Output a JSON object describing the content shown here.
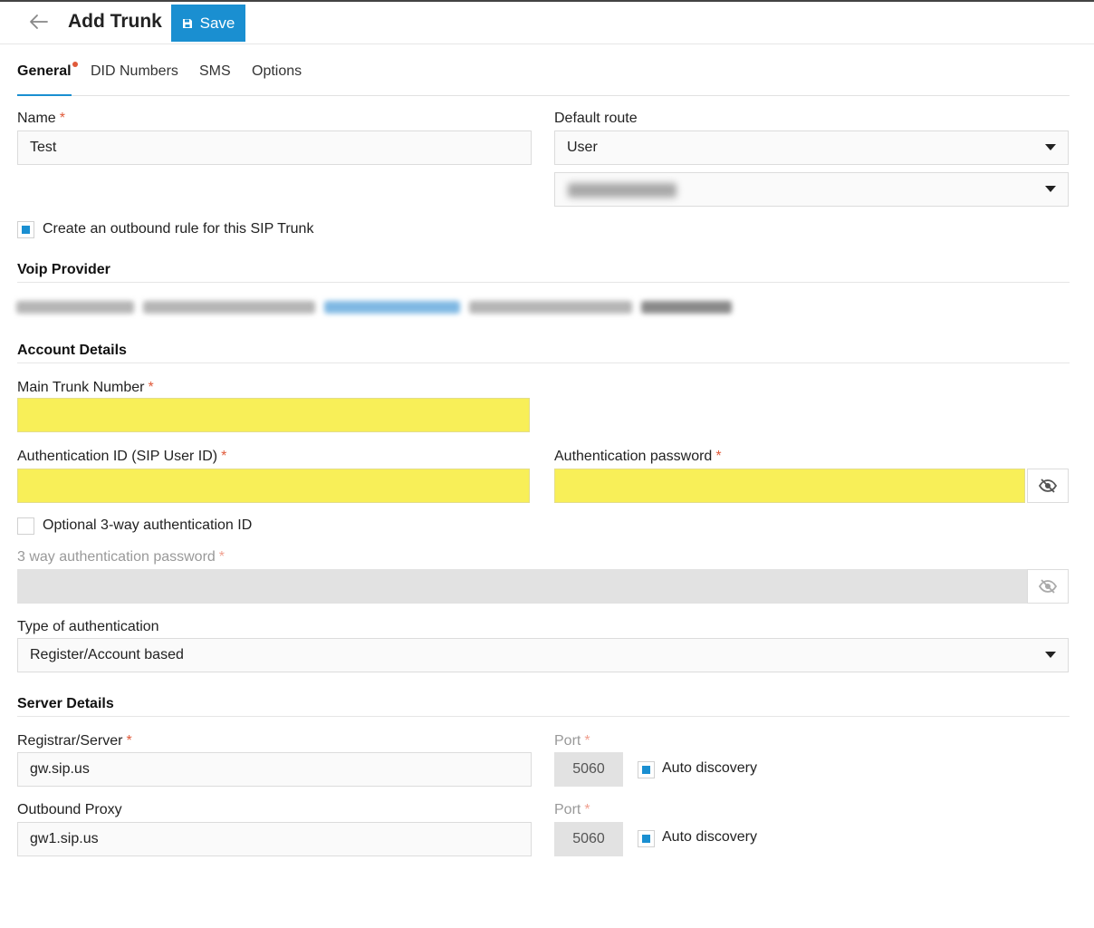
{
  "header": {
    "title": "Add Trunk",
    "save_label": "Save"
  },
  "tabs": [
    {
      "label": "General",
      "active": true,
      "has_error": true
    },
    {
      "label": "DID Numbers",
      "active": false
    },
    {
      "label": "SMS",
      "active": false
    },
    {
      "label": "Options",
      "active": false
    }
  ],
  "general": {
    "name": {
      "label": "Name",
      "value": "Test"
    },
    "default_route": {
      "label": "Default route",
      "value": "User"
    },
    "outbound_rule": {
      "label": "Create an outbound rule for this SIP Trunk",
      "checked": true
    }
  },
  "voip_provider": {
    "title": "Voip Provider"
  },
  "account": {
    "title": "Account Details",
    "main_trunk_number": {
      "label": "Main Trunk Number",
      "value": ""
    },
    "auth_id": {
      "label": "Authentication ID (SIP User ID)",
      "value": ""
    },
    "auth_password": {
      "label": "Authentication password",
      "value": ""
    },
    "three_way_id": {
      "label": "Optional 3-way authentication ID",
      "checked": false
    },
    "three_way_password": {
      "label": "3 way authentication password",
      "value": ""
    },
    "auth_type": {
      "label": "Type of authentication",
      "value": "Register/Account based"
    }
  },
  "server": {
    "title": "Server Details",
    "registrar": {
      "label": "Registrar/Server",
      "value": "gw.sip.us",
      "port_label": "Port",
      "port": "5060",
      "auto_discovery_label": "Auto discovery",
      "auto_discovery": true
    },
    "outbound_proxy": {
      "label": "Outbound Proxy",
      "value": "gw1.sip.us",
      "port_label": "Port",
      "port": "5060",
      "auto_discovery_label": "Auto discovery",
      "auto_discovery": true
    }
  },
  "colors": {
    "accent": "#1a8fd1",
    "required": "#e05a3a",
    "highlight": "#f8ef58"
  }
}
